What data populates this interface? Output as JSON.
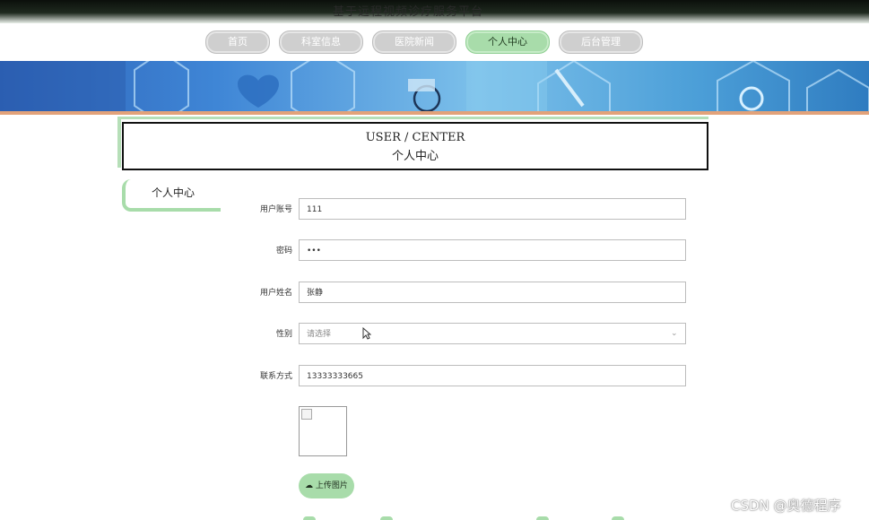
{
  "site": {
    "title": "基于远程视频诊疗服务平台"
  },
  "nav": {
    "items": [
      {
        "label": "首页",
        "active": false
      },
      {
        "label": "科室信息",
        "active": false
      },
      {
        "label": "医院新闻",
        "active": false
      },
      {
        "label": "个人中心",
        "active": true
      },
      {
        "label": "后台管理",
        "active": false
      }
    ]
  },
  "heading": {
    "en": "USER / CENTER",
    "cn": "个人中心"
  },
  "side_tab": {
    "label": "个人中心"
  },
  "form": {
    "account": {
      "label": "用户账号",
      "value": "111"
    },
    "password": {
      "label": "密码",
      "value": "•••"
    },
    "name": {
      "label": "用户姓名",
      "value": "张静"
    },
    "gender": {
      "label": "性别",
      "value": "请选择"
    },
    "phone": {
      "label": "联系方式",
      "value": "13333333665"
    }
  },
  "upload": {
    "label": "上传图片",
    "icon": "cloud-upload-icon"
  },
  "watermark": "CSDN @奥德程序",
  "colors": {
    "accent": "#a8dcaa",
    "nav_inactive": "#cfcfcf",
    "banner": "#3f86d6"
  }
}
